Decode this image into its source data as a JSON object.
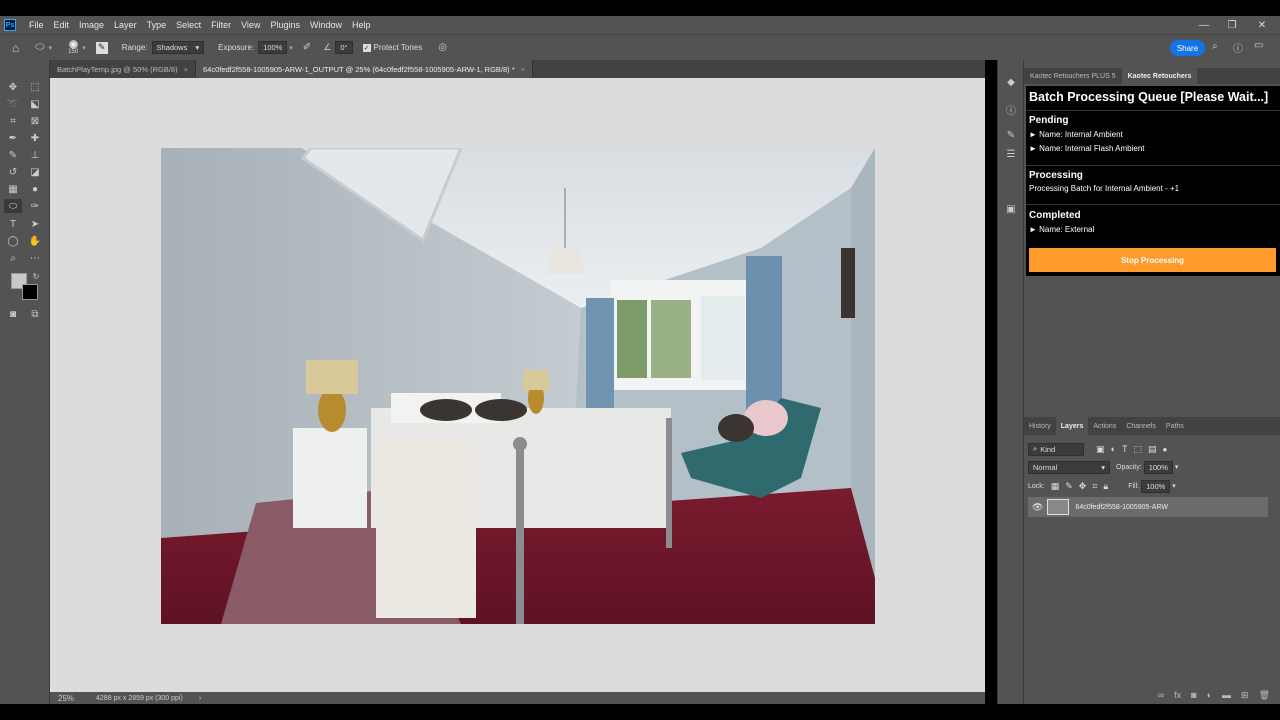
{
  "menu": [
    "File",
    "Edit",
    "Image",
    "Layer",
    "Type",
    "Select",
    "Filter",
    "View",
    "Plugins",
    "Window",
    "Help"
  ],
  "app_logo": "Ps",
  "options": {
    "brush_size": "150",
    "range_label": "Range:",
    "range_value": "Shadows",
    "exposure_label": "Exposure:",
    "exposure_value": "100%",
    "angle_value": "0°",
    "protect_tones": "Protect Tones",
    "share": "Share"
  },
  "tabs": [
    {
      "label": "BatchPlayTemp.jpg @ 50% (RGB/8)"
    },
    {
      "label": "64c0fedf2f558-1005905-ARW-1_OUTPUT @ 25% (64c0fedf2f558-1005905-ARW-1, RGB/8) *"
    }
  ],
  "status": {
    "zoom": "25%",
    "info": "4288 px x 2859 px (300 ppi)"
  },
  "panel_tabs": [
    "Kaotec Retouchers PLUS 5",
    "Kaotec Retouchers"
  ],
  "queue": {
    "title": "Batch Processing Queue [Please Wait...]",
    "pending_label": "Pending",
    "pending": [
      "► Name: Internal Ambient",
      "► Name: Internal Flash Ambient"
    ],
    "processing_label": "Processing",
    "processing_item": "Processing Batch for Internal Ambient - +1",
    "completed_label": "Completed",
    "completed": [
      "► Name: External"
    ],
    "stop_button": "Stop Processing"
  },
  "layers_tabs": [
    "History",
    "Layers",
    "Actions",
    "Channels",
    "Paths"
  ],
  "layers": {
    "kind": "Kind",
    "blend": "Normal",
    "opacity_label": "Opacity:",
    "opacity": "100%",
    "lock_label": "Lock:",
    "fill_label": "Fill:",
    "fill": "100%",
    "layer_name": "64c0fedf2f558-1005905-ARW"
  },
  "colors": {
    "accent": "#ff9a2b",
    "share": "#1473e6",
    "ui": "#535353"
  }
}
